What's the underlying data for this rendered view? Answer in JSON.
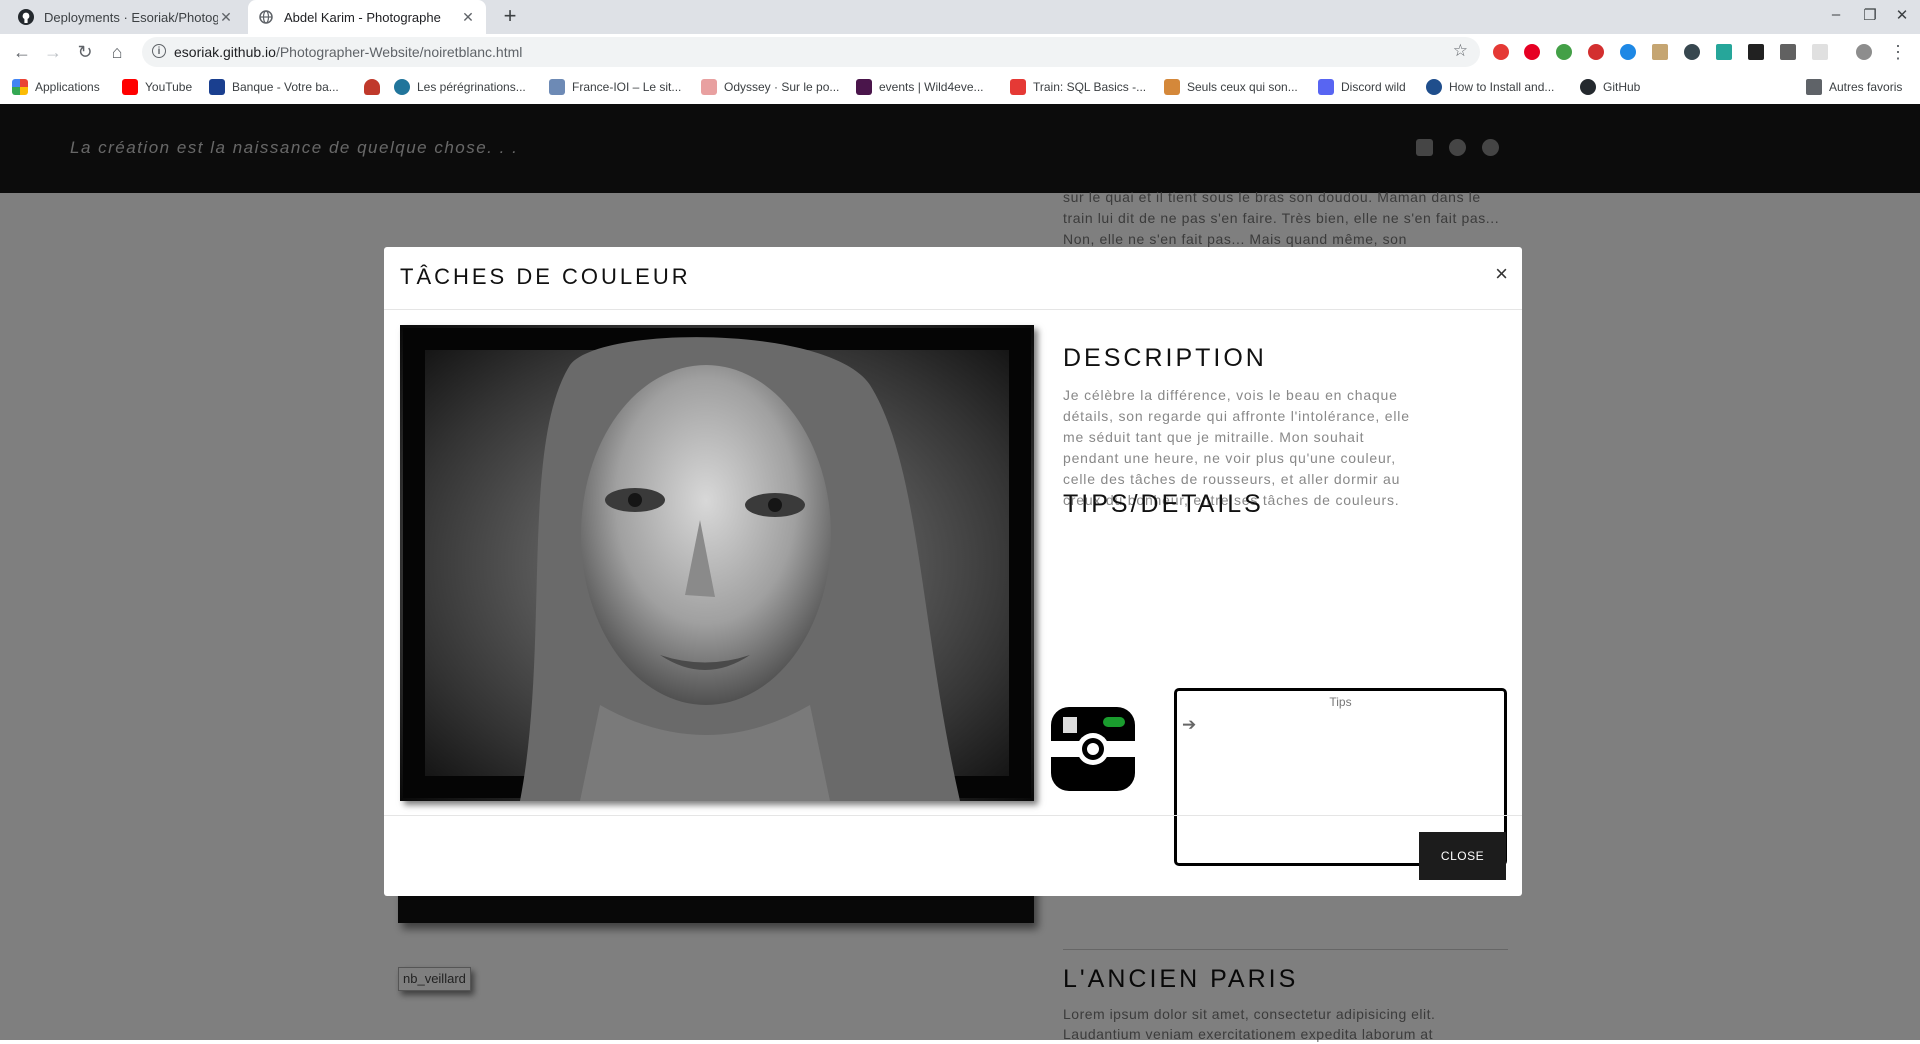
{
  "browser": {
    "tabs": [
      {
        "title": "Deployments · Esoriak/Photographer",
        "icon": "github-icon",
        "active": false
      },
      {
        "title": "Abdel Karim - Photographe",
        "icon": "globe-icon",
        "active": true
      }
    ],
    "url_host": "esoriak.github.io",
    "url_path": "/Photographer-Website/noiretblanc.html",
    "bookmarks": [
      "Applications",
      "YouTube",
      "Banque - Votre ba...",
      "",
      "Les pérégrinations...",
      "France-IOI – Le sit...",
      "Odyssey · Sur le po...",
      "events | Wild4eve...",
      "Train: SQL Basics -...",
      "Seuls ceux qui son...",
      "Discord wild",
      "How to Install and...",
      "GitHub"
    ],
    "other_bookmarks": "Autres favoris"
  },
  "site": {
    "tagline": "La création est la naissance de quelque chose. . .",
    "bg_text": "sur le quai et il tient sous le bras son doudou. Maman dans le train lui dit de ne pas s'en faire. Très bien, elle ne s'en fait pas... Non, elle ne s'en fait pas... Mais quand même, son",
    "broken_image_alt": "nb_veillard",
    "next_title": "L'ANCIEN PARIS",
    "next_text": "Lorem ipsum dolor sit amet, consectetur adipisicing elit. Laudantium veniam exercitationem expedita laborum at"
  },
  "modal": {
    "title": "TÂCHES DE COULEUR",
    "close_x": "×",
    "description_title": "DESCRIPTION",
    "description": "Je célèbre la différence, vois le beau en chaque détails, son regarde qui affronte l'intolérance, elle me séduit tant que je mitraille. Mon souhait pendant une heure, ne voir plus qu'une couleur, celle des tâches de rousseurs, et aller dormir au creux du bonheur, entre ses tâches de couleurs.",
    "tips_title": "TIPS/DETAILS",
    "tips_label": "Tips",
    "tips_arrow": "➔",
    "close_button": "CLOSE"
  },
  "colors": {
    "header_bg": "#191919",
    "overlay": "rgba(0,0,0,0.5)",
    "close_button_bg": "#1c1c1c"
  }
}
